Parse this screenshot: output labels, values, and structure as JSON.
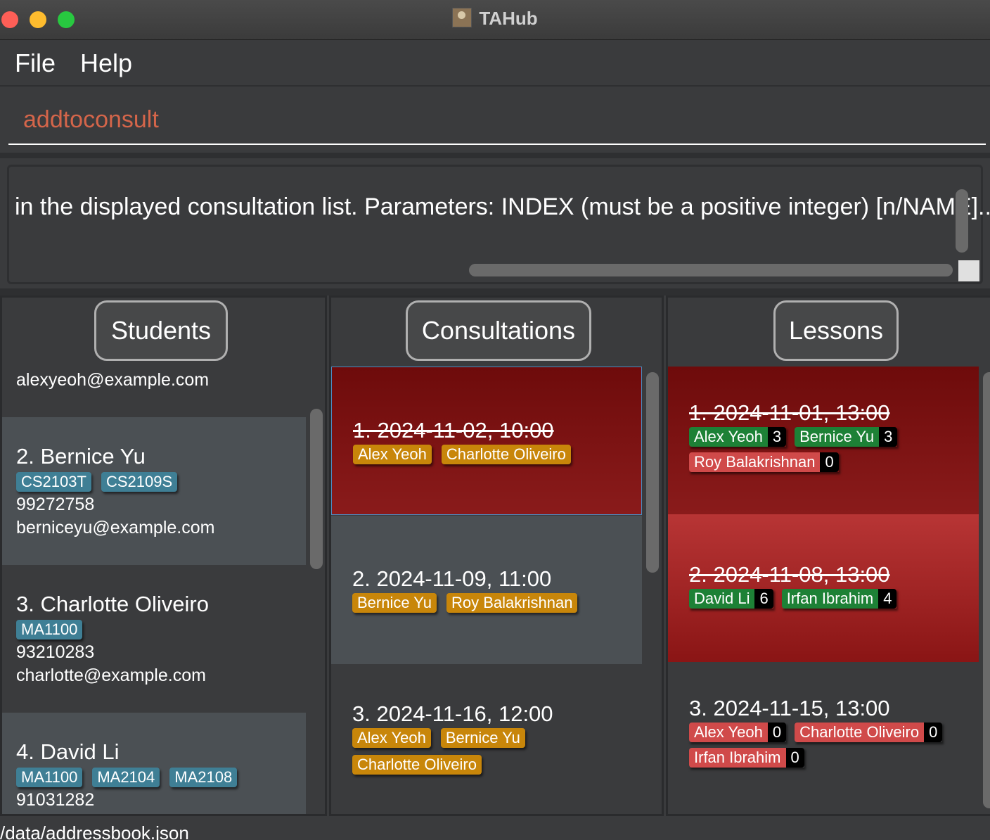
{
  "window": {
    "title": "TAHub"
  },
  "menu": {
    "file": "File",
    "help": "Help"
  },
  "command": {
    "value": "addtoconsult"
  },
  "result": {
    "text": "in the displayed consultation list. Parameters: INDEX (must be a positive integer) [n/NAME]..."
  },
  "panels": {
    "students": "Students",
    "consultations": "Consultations",
    "lessons": "Lessons"
  },
  "students": [
    {
      "email": "alexyeoh@example.com"
    },
    {
      "name": "2. Bernice Yu",
      "courses": [
        "CS2103T",
        "CS2109S"
      ],
      "phone": "99272758",
      "email": "berniceyu@example.com"
    },
    {
      "name": "3. Charlotte Oliveiro",
      "courses": [
        "MA1100"
      ],
      "phone": "93210283",
      "email": "charlotte@example.com"
    },
    {
      "name": "4. David Li",
      "courses": [
        "MA1100",
        "MA2104",
        "MA2108"
      ],
      "phone": "91031282"
    }
  ],
  "consultations": [
    {
      "title": "1. 2024-11-02, 10:00",
      "students": [
        "Alex Yeoh",
        "Charlotte Oliveiro"
      ]
    },
    {
      "title": "2. 2024-11-09, 11:00",
      "students": [
        "Bernice Yu",
        "Roy Balakrishnan"
      ]
    },
    {
      "title": "3. 2024-11-16, 12:00",
      "students": [
        "Alex Yeoh",
        "Bernice Yu",
        "Charlotte Oliveiro"
      ]
    }
  ],
  "lessons": [
    {
      "title": "1. 2024-11-01, 13:00",
      "attendees": [
        {
          "name": "Alex Yeoh",
          "count": "3"
        },
        {
          "name": "Bernice Yu",
          "count": "3"
        },
        {
          "name": "Roy Balakrishnan",
          "count": "0"
        }
      ]
    },
    {
      "title": "2. 2024-11-08, 13:00",
      "attendees": [
        {
          "name": "David Li",
          "count": "6"
        },
        {
          "name": "Irfan Ibrahim",
          "count": "4"
        }
      ]
    },
    {
      "title": "3. 2024-11-15, 13:00",
      "attendees": [
        {
          "name": "Alex Yeoh",
          "count": "0"
        },
        {
          "name": "Charlotte Oliveiro",
          "count": "0"
        },
        {
          "name": "Irfan Ibrahim",
          "count": "0"
        }
      ]
    }
  ],
  "status": {
    "path": "/data/addressbook.json"
  },
  "colors": {
    "attended": "#1d8136",
    "absent": "#d04a4a",
    "student_tag": "#c8860a",
    "course_tag": "#3f7f95",
    "past": "#8a1b1b"
  }
}
